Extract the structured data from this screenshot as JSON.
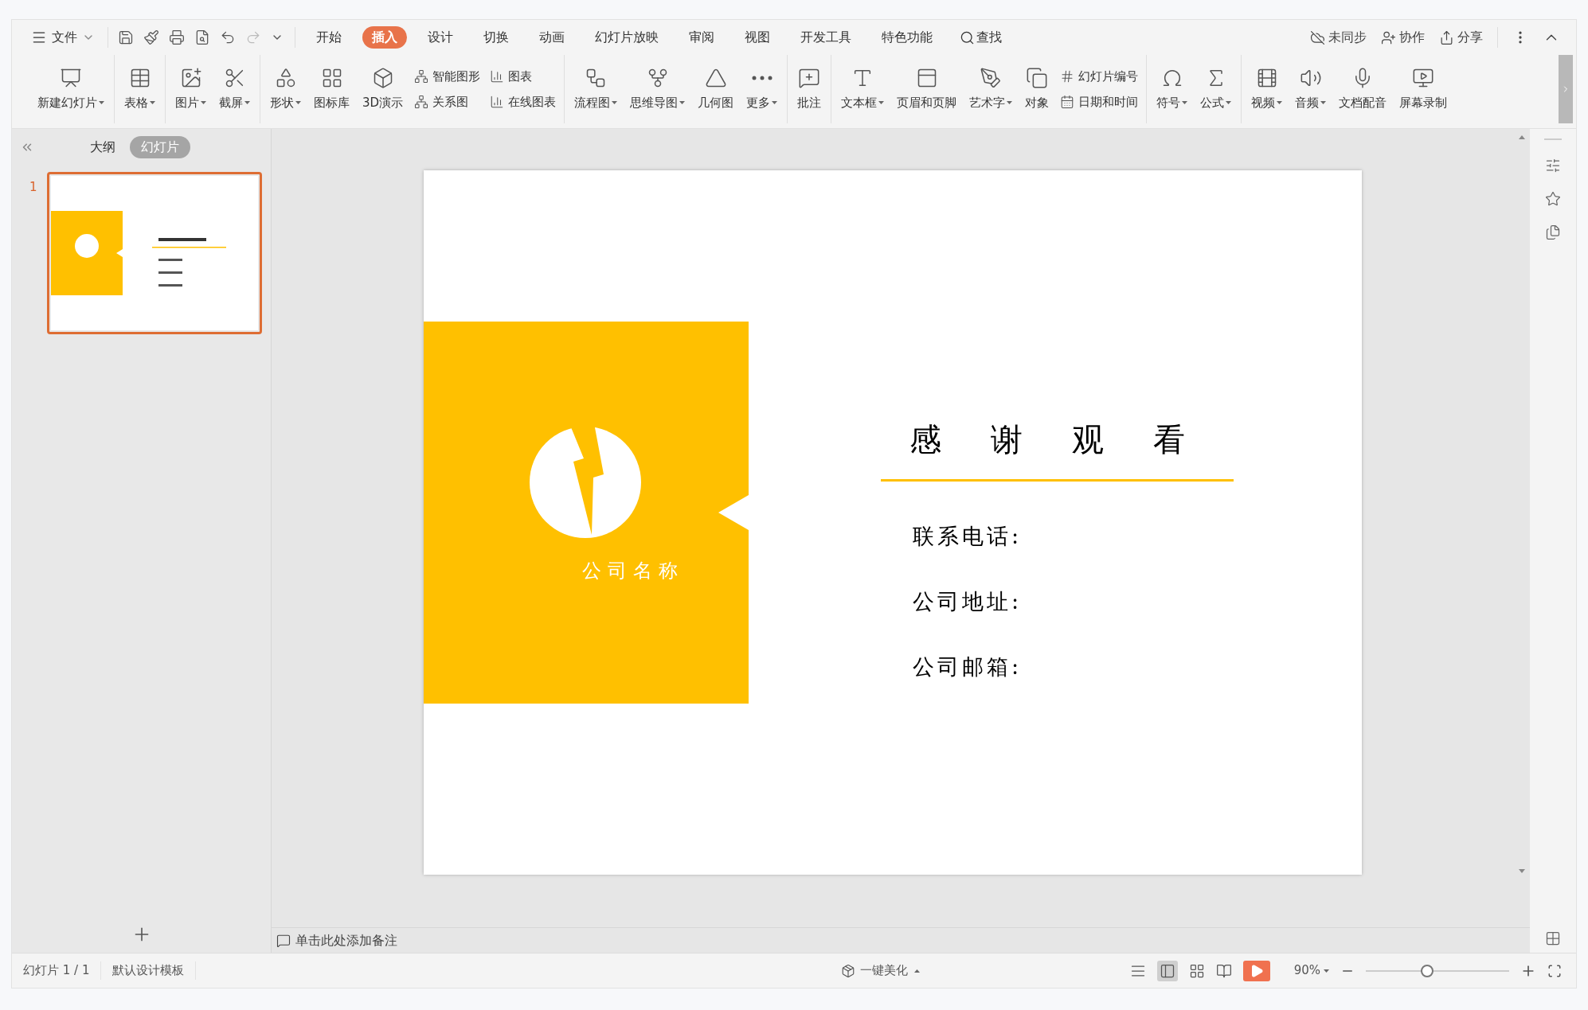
{
  "menu": {
    "label": "文件"
  },
  "tabs": [
    {
      "label": "开始",
      "selected": false
    },
    {
      "label": "插入",
      "selected": true
    },
    {
      "label": "设计",
      "selected": false
    },
    {
      "label": "切换",
      "selected": false
    },
    {
      "label": "动画",
      "selected": false
    },
    {
      "label": "幻灯片放映",
      "selected": false
    },
    {
      "label": "审阅",
      "selected": false
    },
    {
      "label": "视图",
      "selected": false
    },
    {
      "label": "开发工具",
      "selected": false
    },
    {
      "label": "特色功能",
      "selected": false
    }
  ],
  "search": {
    "label": "查找"
  },
  "top_actions": [
    {
      "label": "未同步"
    },
    {
      "label": "协作"
    },
    {
      "label": "分享"
    }
  ],
  "ribbon": [
    {
      "items": [
        {
          "kind": "large",
          "label": "新建幻灯片",
          "dropdown": true
        }
      ]
    },
    {
      "items": [
        {
          "kind": "large",
          "label": "表格",
          "dropdown": true
        }
      ]
    },
    {
      "items": [
        {
          "kind": "large",
          "label": "图片",
          "dropdown": true
        },
        {
          "kind": "large",
          "label": "截屏",
          "dropdown": true
        }
      ]
    },
    {
      "items": [
        {
          "kind": "large",
          "label": "形状",
          "dropdown": true
        },
        {
          "kind": "large",
          "label": "图标库",
          "dropdown": false
        },
        {
          "kind": "large",
          "label": "3D演示",
          "dropdown": false
        },
        {
          "kind": "pair",
          "items": [
            {
              "label": "智能图形"
            },
            {
              "label": "关系图"
            }
          ]
        },
        {
          "kind": "pair",
          "items": [
            {
              "label": "图表"
            },
            {
              "label": "在线图表"
            }
          ]
        }
      ]
    },
    {
      "items": [
        {
          "kind": "large",
          "label": "流程图",
          "dropdown": true
        },
        {
          "kind": "large",
          "label": "思维导图",
          "dropdown": true
        },
        {
          "kind": "large",
          "label": "几何图",
          "dropdown": false
        },
        {
          "kind": "large",
          "label": "更多",
          "dropdown": true
        }
      ]
    },
    {
      "items": [
        {
          "kind": "large",
          "label": "批注",
          "dropdown": false
        }
      ]
    },
    {
      "items": [
        {
          "kind": "large",
          "label": "文本框",
          "dropdown": true
        },
        {
          "kind": "large",
          "label": "页眉和页脚",
          "dropdown": false
        },
        {
          "kind": "large",
          "label": "艺术字",
          "dropdown": true
        },
        {
          "kind": "large",
          "label": "对象",
          "dropdown": false
        },
        {
          "kind": "pair",
          "items": [
            {
              "label": "幻灯片编号"
            },
            {
              "label": "日期和时间"
            }
          ]
        }
      ]
    },
    {
      "items": [
        {
          "kind": "large",
          "label": "符号",
          "dropdown": true
        },
        {
          "kind": "large",
          "label": "公式",
          "dropdown": true
        }
      ]
    },
    {
      "items": [
        {
          "kind": "large",
          "label": "视频",
          "dropdown": true
        },
        {
          "kind": "large",
          "label": "音频",
          "dropdown": true
        },
        {
          "kind": "large",
          "label": "文档配音",
          "dropdown": false
        },
        {
          "kind": "large",
          "label": "屏幕录制",
          "dropdown": false
        }
      ]
    }
  ],
  "panel": {
    "views": [
      {
        "label": "大纲",
        "selected": false
      },
      {
        "label": "幻灯片",
        "selected": true
      }
    ],
    "slides": [
      {
        "number": "1",
        "selected": true
      }
    ]
  },
  "slide": {
    "company": "公司名称",
    "title": "感谢观看",
    "fields": [
      "联系电话:",
      "公司地址:",
      "公司邮箱:"
    ]
  },
  "notes": {
    "placeholder": "单击此处添加备注"
  },
  "status_bar": {
    "slide_count": "幻灯片 1 / 1",
    "template": "默认设计模板",
    "beautify": "一键美化",
    "zoom": {
      "reading": "90%",
      "level": 0.43
    }
  }
}
